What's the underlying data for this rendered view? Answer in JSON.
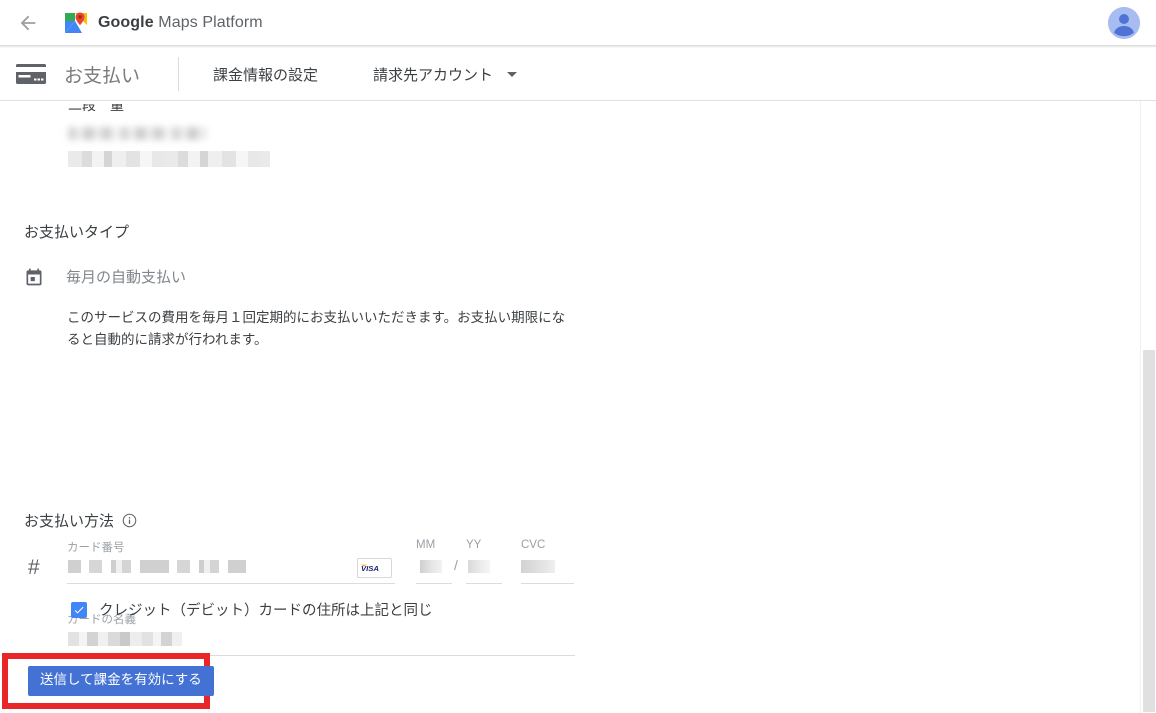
{
  "top_bar": {
    "back_label": "戻る",
    "brand_bold": "Google",
    "brand_light": " Maps Platform",
    "avatar_label": "アカウント"
  },
  "sub_header": {
    "payments_title": "お支払い",
    "nav_billing_settings": "課金情報の設定",
    "nav_billing_account": "請求先アカウント"
  },
  "payment_type": {
    "section_title": "お支払いタイプ",
    "option_label": "毎月の自動支払い",
    "description": "このサービスの費用を毎月１回定期的にお支払いいただきます。お支払い期限になると自動的に請求が行われます。"
  },
  "payment_method": {
    "section_title": "お支払い方法",
    "card_number_label": "カード番号",
    "card_number_value": "",
    "mm_label": "MM",
    "mm_value": "",
    "yy_label": "YY",
    "yy_value": "",
    "separator": "/",
    "cvc_label": "CVC",
    "cvc_value": "",
    "card_name_label": "カードの名義",
    "card_name_value": "",
    "card_brand": "VISA"
  },
  "checkbox": {
    "label": "クレジット（デビット）カードの住所は上記と同じ",
    "checked": true
  },
  "submit": {
    "label": "送信して課金を有効にする"
  },
  "colors": {
    "accent_blue": "#4285f4",
    "button_blue": "#4472d4",
    "annotation_red": "#e8262a",
    "text_primary": "#3c4043",
    "text_secondary": "#80868b"
  }
}
